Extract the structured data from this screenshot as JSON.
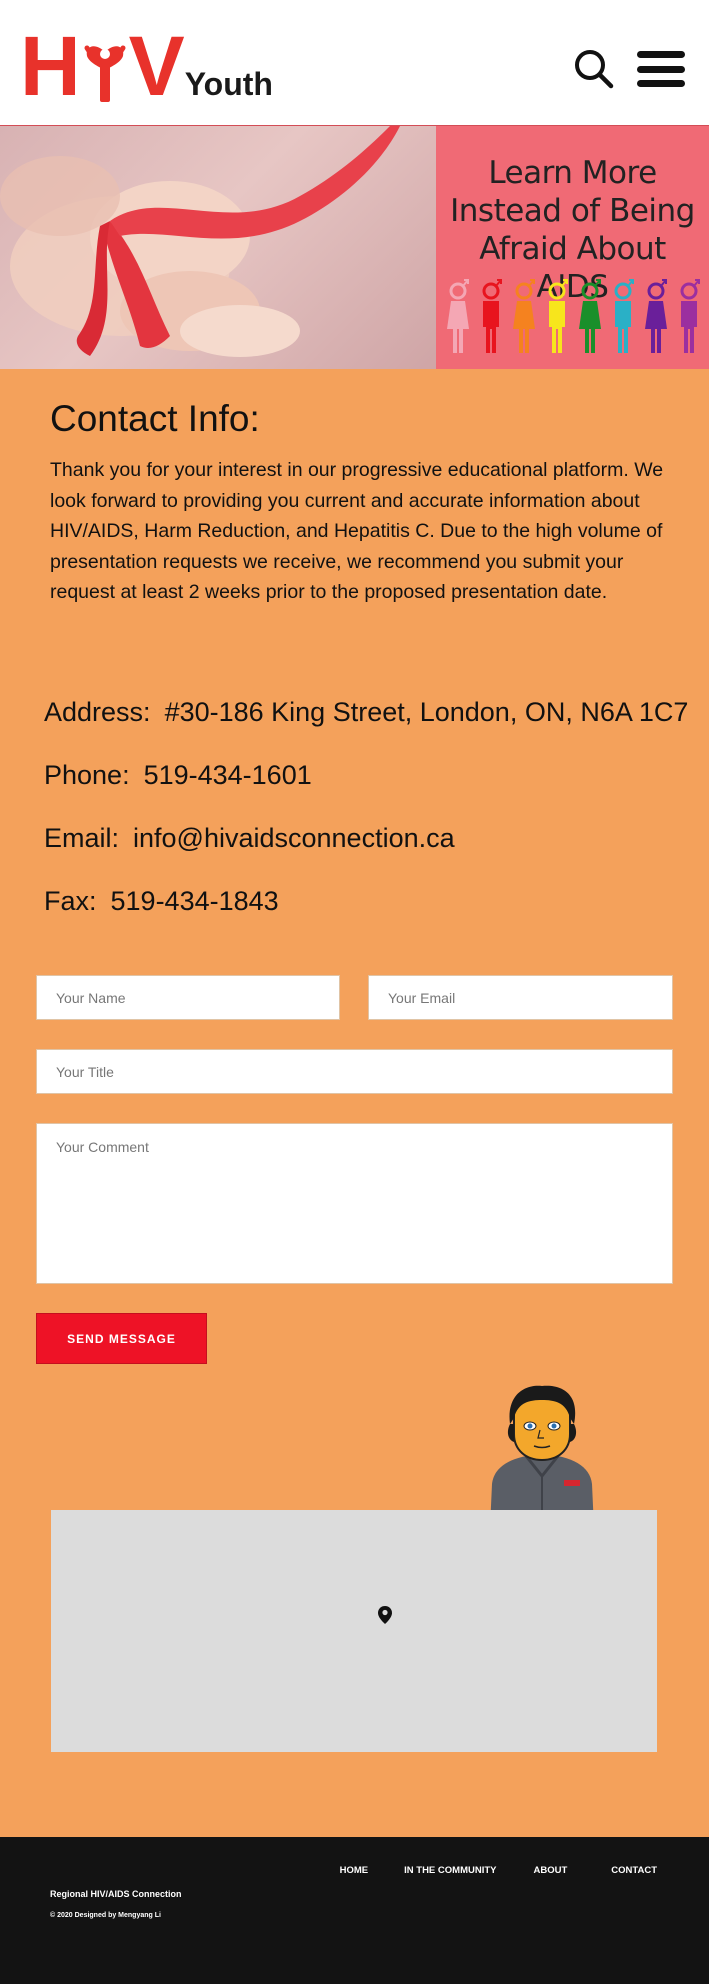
{
  "header": {
    "logo": {
      "letters": [
        "H",
        "V"
      ],
      "youth": "Youth",
      "brand_color": "#e8322b"
    },
    "icons": [
      "search-icon",
      "menu-icon"
    ]
  },
  "banner": {
    "headline": "Learn More Instead of Being Afraid About AIDS",
    "panel_color": "#f06a75",
    "figure_colors": [
      "#f4a7b4",
      "#e8141e",
      "#f5821f",
      "#f7e51c",
      "#1a8f2a",
      "#2ab0c6",
      "#6a1f9a",
      "#9b2f9f"
    ]
  },
  "contact": {
    "title": "Contact Info:",
    "intro": "Thank you for your interest in our progressive educational platform. We look forward to providing you current and accurate information about HIV/AIDS, Harm Reduction, and Hepatitis C. Due to the high volume of presentation requests we receive, we recommend you submit your request at least 2 weeks prior to the proposed presentation date.",
    "address_label": "Address:",
    "address": "#30-186 King Street, London, ON, N6A 1C7",
    "phone_label": "Phone:",
    "phone": "519-434-1601",
    "email_label": "Email:",
    "email": "info@hivaidsconnection.ca",
    "fax_label": "Fax:",
    "fax": "519-434-1843"
  },
  "form": {
    "name_placeholder": "Your Name",
    "email_placeholder": "Your Email",
    "title_placeholder": "Your Title",
    "comment_placeholder": "Your Comment",
    "submit_label": "SEND MESSAGE",
    "submit_color": "#ee1226"
  },
  "footer": {
    "nav": [
      "HOME",
      "IN THE COMMUNITY",
      "ABOUT",
      "CONTACT"
    ],
    "org": "Regional HIV/AIDS Connection",
    "copyright": "© 2020 Designed by Mengyang Li"
  },
  "colors": {
    "page_bg": "#f4a15b",
    "footer_bg": "#131313",
    "map_bg": "#dcdcdc"
  }
}
